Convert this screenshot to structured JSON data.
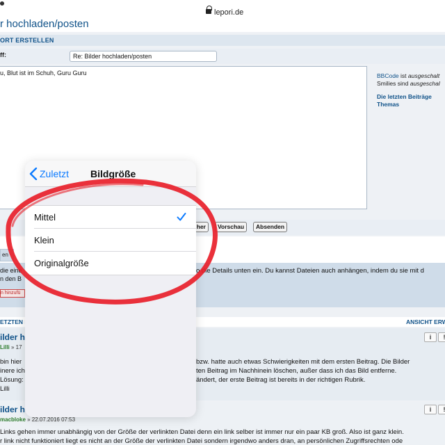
{
  "browser": {
    "url": "lepori.de"
  },
  "page": {
    "title": "r hochladen/posten",
    "section_header": "ORT ERSTELLEN",
    "subject_label": "ff:",
    "subject_value": "Re: Bilder hochladen/posten",
    "editor_text": "u, Blut ist im Schuh, Guru Guru"
  },
  "side_info": {
    "bbcode_link": "BBCode",
    "bbcode_rest": " ist ",
    "bbcode_state": "ausgeschalt",
    "smilies_prefix": "Smilies sind ",
    "smilies_state": "ausgeschal",
    "last_posts": "Die letzten Beiträge",
    "topics": "Themas"
  },
  "buttons": {
    "preview_partial": "her",
    "preview": "Vorschau",
    "submit": "Absenden"
  },
  "attachments": {
    "tab_label": "en",
    "hint": "Details unten ein. Du kannst Dateien auch anhängen, indem du sie mit d",
    "left_line1": "die eine",
    "left_line2": "n den B",
    "add_button": "n hinzufü",
    "partial_hint_left": "o die"
  },
  "posts": {
    "header_left": "ETZTEN BEI",
    "header_right": "ANSICHT ERW",
    "items": [
      {
        "title": "ilder h",
        "meta_author": "Lilli",
        "meta_rest": " » 17",
        "lines_left": [
          "bin hier",
          "inere ich",
          "Lösung:",
          "Lilli"
        ],
        "lines_right": [
          "bzw. hatte auch etwas Schwierigkeiten mit dem ersten Beitrag. Die Bilder",
          "ten Beitrag im Nachhinein löschen, außer dass ich das Bild entferne.",
          "ändert, der erste Beitrag ist bereits in der richtigen Rubrik."
        ]
      },
      {
        "title": "ilder h",
        "meta_author": "macbloke",
        "meta_rest": " » 22.07.2016 07:53",
        "lines": [
          "Links gehen immer unabhängig von der Größe der verlinkten Datei denn ein link selber ist immer nur ein paar KB groß. Also ist ganz klein.",
          "r link nicht funktioniert liegt es nicht an der Größe der verlinkten Datei sondern irgendwo anders dran, an persönlichen Zugriffsrechten ode"
        ]
      }
    ],
    "icon_info": "i",
    "icon_quote": "!"
  },
  "popover": {
    "back_label": "Zuletzt",
    "title": "Bildgröße",
    "options": [
      {
        "label": "Mittel",
        "selected": true
      },
      {
        "label": "Klein",
        "selected": false
      },
      {
        "label": "Originalgröße",
        "selected": false
      }
    ]
  },
  "colors": {
    "ios_blue": "#0a7aff",
    "annotation_red": "#e8202a",
    "forum_link": "#105289"
  }
}
